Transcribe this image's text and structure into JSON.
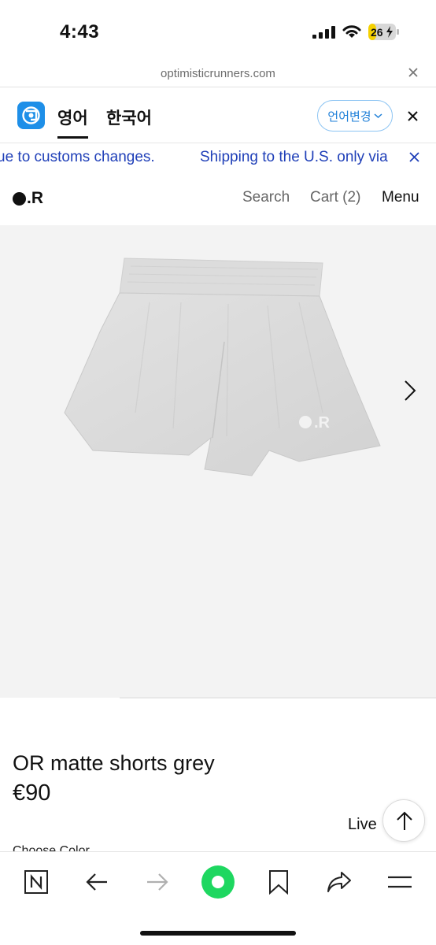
{
  "status_bar": {
    "time": "4:43",
    "battery": "26"
  },
  "browser": {
    "url": "optimisticrunners.com"
  },
  "translate": {
    "tab_source": "영어",
    "tab_target": "한국어",
    "change_language": "언어변경",
    "accent_color": "#1e8fe8"
  },
  "banner": {
    "text_left": "ue to customs changes.",
    "text_right": "Shipping to the U.S. only via",
    "color": "#1f3fb8"
  },
  "site": {
    "logo_text": ".R",
    "nav": {
      "search": "Search",
      "cart": "Cart (2)",
      "menu": "Menu"
    }
  },
  "product": {
    "image_watermark": ".R",
    "title": "OR matte shorts grey",
    "price": "€90",
    "live_label": "Live",
    "choose_color": "Choose Color"
  },
  "toolbar": {
    "icons": [
      "notes-icon",
      "back-arrow-icon",
      "forward-arrow-icon",
      "home-dot-icon",
      "bookmark-icon",
      "share-icon",
      "menu-lines-icon"
    ],
    "home_color": "#1ed760"
  }
}
